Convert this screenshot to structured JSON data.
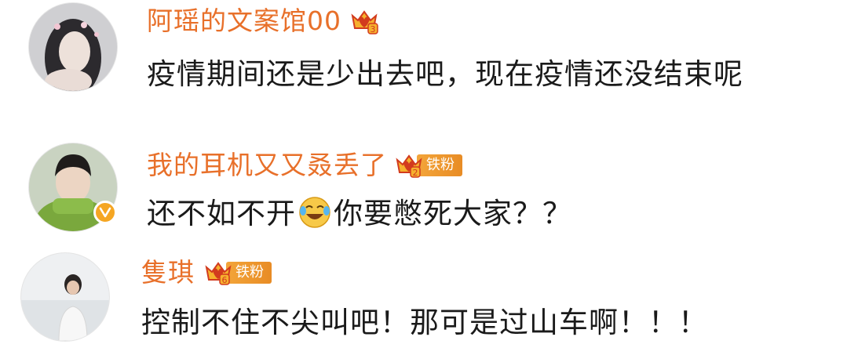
{
  "comments": [
    {
      "username": "阿瑶的文案馆00",
      "crown_level": "3",
      "text": "疫情期间还是少出去吧，现在疫情还没结束呢",
      "verified": false,
      "fan_label": ""
    },
    {
      "username": "我的耳机又又叒丢了",
      "crown_level": "2",
      "fan_label": "铁粉",
      "text_before": "还不如不开",
      "emoji": "laugh-cry-emoji",
      "text_after": "你要憋死大家？？",
      "verified": true
    },
    {
      "username": "隻琪",
      "crown_level": "6",
      "fan_label": "铁粉",
      "text": "控制不住不尖叫吧！那可是过山车啊！！！",
      "verified": false
    }
  ],
  "colors": {
    "username": "#e8702a",
    "text": "#1a1a1a",
    "badge": "#f3a53a",
    "verified": "#f5a623"
  }
}
